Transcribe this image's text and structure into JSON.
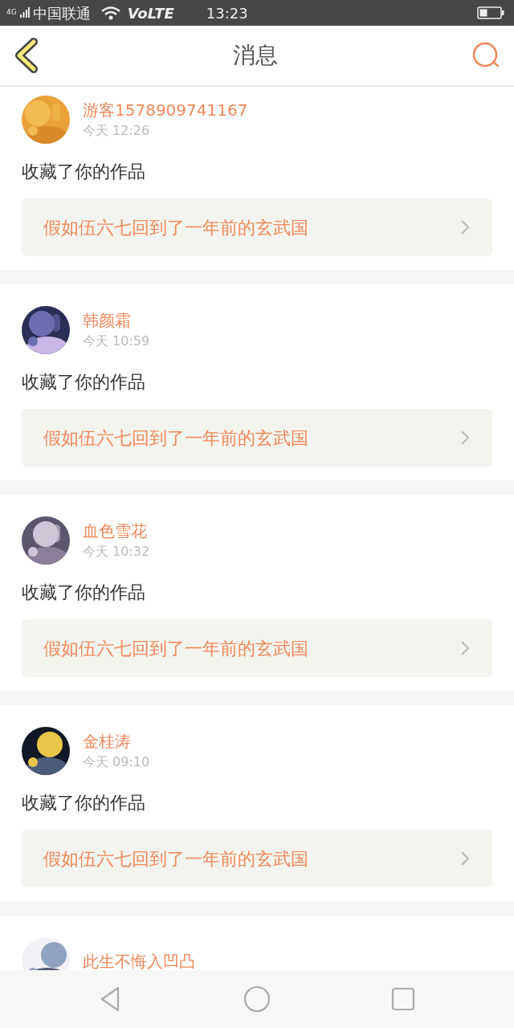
{
  "status_bar": {
    "network": "4G",
    "carrier": "中国联通",
    "volte": "VoLTE",
    "time": "13:23"
  },
  "header": {
    "title": "消息"
  },
  "messages": [
    {
      "user": "游客1578909741167",
      "time": "今天 12:26",
      "action": "收藏了你的作品",
      "work": "假如伍六七回到了一年前的玄武国"
    },
    {
      "user": "韩颜霜",
      "time": "今天 10:59",
      "action": "收藏了你的作品",
      "work": "假如伍六七回到了一年前的玄武国"
    },
    {
      "user": "血色雪花",
      "time": "今天 10:32",
      "action": "收藏了你的作品",
      "work": "假如伍六七回到了一年前的玄武国"
    },
    {
      "user": "金桂涛",
      "time": "今天 09:10",
      "action": "收藏了你的作品",
      "work": "假如伍六七回到了一年前的玄武国"
    },
    {
      "user": "此生不悔入凹凸"
    }
  ]
}
